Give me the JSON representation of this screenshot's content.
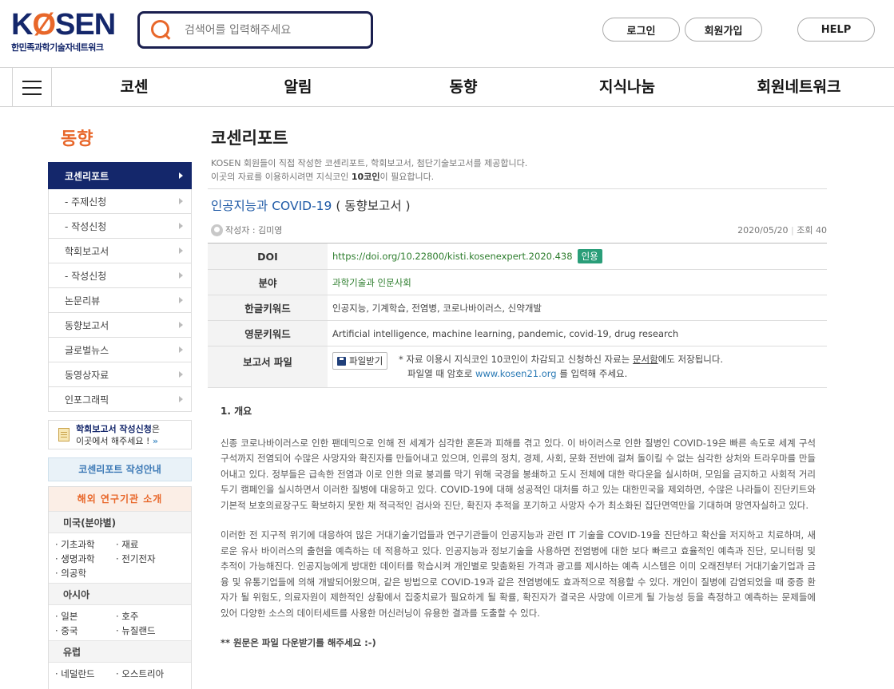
{
  "header": {
    "logo_main_pre": "K",
    "logo_main_o": "Ø",
    "logo_main_post": "SEN",
    "logo_sub": "한민족과학기술자네트워크",
    "search_placeholder": "검색어를 입력해주세요",
    "login": "로그인",
    "signup": "회원가입",
    "help": "HELP"
  },
  "nav": [
    "코센",
    "알림",
    "동향",
    "지식나눔",
    "회원네트워크"
  ],
  "sidebar": {
    "title": "동향",
    "items": [
      {
        "label": "코센리포트",
        "active": true
      },
      {
        "label": "- 주제신청"
      },
      {
        "label": "- 작성신청"
      },
      {
        "label": "학회보고서"
      },
      {
        "label": "- 작성신청"
      },
      {
        "label": "논문리뷰"
      },
      {
        "label": "동향보고서"
      },
      {
        "label": "글로벌뉴스"
      },
      {
        "label": "동영상자료"
      },
      {
        "label": "인포그래픽"
      }
    ],
    "apply_strong": "학회보고서 작성신청",
    "apply_tail": "은",
    "apply_line2": "이곳에서 해주세요 !",
    "apply_chevron": "»",
    "guide_button": "코센리포트 작성안내",
    "inst_title": "해외 연구기관 소개",
    "regions": [
      {
        "name": "미국(분야별)",
        "cities": [
          "· 기초과학",
          "· 재료",
          "· 생명과학",
          "· 전기전자",
          "· 의공학"
        ]
      },
      {
        "name": "아시아",
        "cities": [
          "· 일본",
          "· 호주",
          "· 중국",
          "· 뉴질랜드"
        ]
      },
      {
        "name": "유럽",
        "cities": [
          "· 네덜란드",
          "· 오스트리아"
        ]
      }
    ]
  },
  "main": {
    "title": "코센리포트",
    "desc_line1": "KOSEN 회원들이 직접 작성한 코센리포트, 학회보고서, 첨단기술보고서를 제공합니다.",
    "desc_line2_pre": "이곳의 자료를 이용하시려면 지식코인 ",
    "desc_line2_bold": "10코인",
    "desc_line2_post": "이 필요합니다.",
    "post_title": "인공지능과 COVID-19",
    "post_kind": " ( 동향보고서 )",
    "author": "작성자 : 김미영",
    "date": "2020/05/20",
    "views": "조회 40",
    "table": {
      "doi_label": "DOI",
      "doi_value": "https://doi.org/10.22800/kisti.kosenexpert.2020.438",
      "cite_label": "인용",
      "category_label": "분야",
      "category_value": "과학기술과 인문사회",
      "kw_ko_label": "한글키워드",
      "kw_ko_value": "인공지능, 기계학습, 전염병, 코로나바이러스, 신약개발",
      "kw_en_label": "영문키워드",
      "kw_en_value": "Artificial intelligence, machine learning, pandemic, covid-19, drug research",
      "file_label": "보고서 파일",
      "download_label": "파일받기",
      "note1_pre": "* 자료 이용시 지식코인 10코인이 차감되고 신청하신 자료는 ",
      "note1_u": "문서함",
      "note1_post": "에도 저장됩니다.",
      "note2_pre": "파일열 때 암호로 ",
      "note2_link": "www.kosen21.org",
      "note2_post": " 를 입력해 주세요."
    },
    "section_heading": "1. 개요",
    "para1": "신종 코로나바이러스로 인한 팬데믹으로 인해 전 세계가 심각한 혼돈과 피해를 겪고 있다. 이 바이러스로 인한 질병인 COVID-19은 빠른 속도로 세계 구석구석까지 전염되어 수많은 사망자와 확진자를 만들어내고 있으며, 인류의 정치, 경제, 사회, 문화 전반에 걸쳐 돌이킬 수 없는 심각한 상처와 트라우마를 만들어내고 있다. 정부들은 급속한 전염과 이로 인한 의료 붕괴를 막기 위해 국경을 봉쇄하고 도시 전체에 대한 락다운을 실시하며, 모임을 금지하고 사회적 거리두기 캠페인을 실시하면서 이러한 질병에 대응하고 있다. COVID-19에 대해 성공적인 대처를 하고 있는 대한민국을 제외하면, 수많은 나라들이 진단키트와 기본적 보호의료장구도 확보하지 못한 채 적극적인 검사와 진단, 확진자 추적을 포기하고 사망자 수가 최소화된 집단면역만을 기대하며 망연자실하고 있다.",
    "para2": "이러한 전 지구적 위기에 대응하여 많은 거대기술기업들과 연구기관들이 인공지능과 관련 IT 기술을 COVID-19을 진단하고 확산을 저지하고 치료하며, 새로운 유사 바이러스의 출현을 예측하는 데 적용하고 있다. 인공지능과 정보기술을 사용하면 전염병에 대한 보다 빠르고 효율적인 예측과 진단, 모니터링 및 추적이 가능해진다. 인공지능에게 방대한 데이터를 학습시켜 개인별로 맞춤화된 가격과 광고를 제시하는 예측 시스템은 이미 오래전부터 거대기술기업과 금융 및 유통기업들에 의해 개발되어왔으며, 같은 방법으로 COVID-19과 같은 전염병에도 효과적으로 적용할 수 있다. 개인이 질병에 감염되었을 때 중증 환자가 될 위험도, 의료자원이 제한적인 상황에서 집중치료가 필요하게 될 확률, 확진자가 결국은 사망에 이르게 될 가능성 등을 측정하고 예측하는 문제들에 있어 다양한 소스의 데이터세트를 사용한 머신러닝이 유용한 결과를 도출할 수 있다.",
    "download_note": "** 원문은 파일 다운받기를 해주세요 :-)"
  }
}
